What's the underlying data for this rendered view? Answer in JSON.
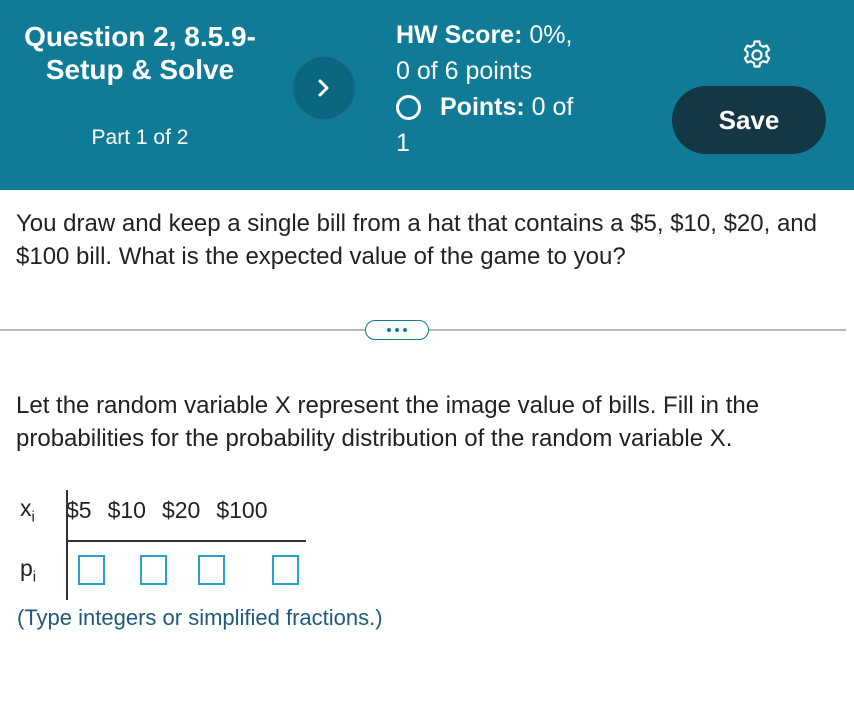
{
  "header": {
    "question_title": "Question 2, 8.5.9-Setup & Solve",
    "question_part": "Part 1 of 2",
    "next_icon": "chevron-right-icon",
    "hw_score_label": "HW Score:",
    "hw_score_value": "0%,",
    "hw_score_points": "0 of 6 points",
    "points_label": "Points:",
    "points_value": "0 of",
    "points_total": "1",
    "settings_icon": "gear-icon",
    "save_label": "Save",
    "color_bar": "#0f7b96",
    "color_save": "#133744"
  },
  "question": {
    "text": "You draw and keep a single bill from a hat that contains a $5, $10, $20, and $100 bill. What is the expected value of the game to you?"
  },
  "divider": {
    "more_icon": "ellipsis-icon"
  },
  "part1": {
    "instructions": "Let the random variable X represent the image value of bills. Fill in the probabilities for the probability distribution of the random variable X.",
    "x_var": "x",
    "x_sub": "i",
    "p_var": "p",
    "p_sub": "i",
    "x_values": [
      "$5",
      "$10",
      "$20",
      "$100"
    ],
    "p_inputs": [
      "",
      "",
      "",
      ""
    ],
    "hint": "(Type integers or simplified fractions.)"
  }
}
